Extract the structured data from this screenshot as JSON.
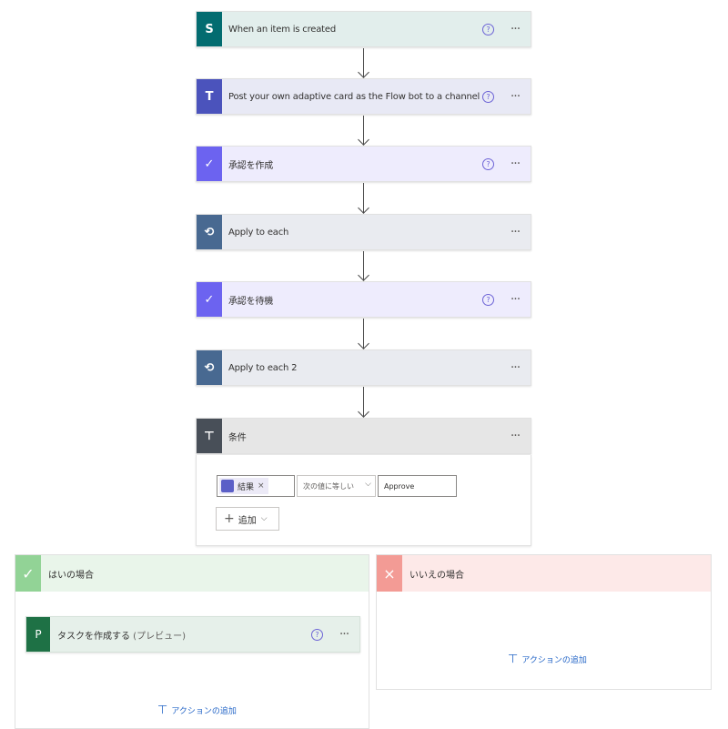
{
  "steps": [
    {
      "title": "When an item is created",
      "icon": "sharepoint-icon",
      "bg": "#e2eeec",
      "icon_bg": "#036c70",
      "glyph": "S",
      "help": "?",
      "more": "···"
    },
    {
      "title": "Post your own adaptive card as the Flow bot to a channel",
      "icon": "teams-icon",
      "bg": "#e8e9f5",
      "icon_bg": "#4b53bc",
      "glyph": "T",
      "help": "?",
      "more": "···"
    },
    {
      "title": "承認を作成",
      "icon": "approvals-icon",
      "bg": "#eeecfd",
      "icon_bg": "#6c63f0",
      "glyph": "✓",
      "help": "?",
      "more": "···"
    },
    {
      "title": "Apply to each",
      "icon": "loop-icon",
      "bg": "#e9ebf0",
      "icon_bg": "#486991",
      "glyph": "⟲",
      "more": "···"
    },
    {
      "title": "承認を待機",
      "icon": "approvals-icon",
      "bg": "#eeecfd",
      "icon_bg": "#6c63f0",
      "glyph": "✓",
      "help": "?",
      "more": "···"
    },
    {
      "title": "Apply to each 2",
      "icon": "loop-icon",
      "bg": "#e9ebf0",
      "icon_bg": "#486991",
      "glyph": "⟲",
      "more": "···"
    },
    {
      "title": "条件",
      "icon": "condition-icon",
      "bg": "#e6e6e6",
      "icon_bg": "#484f58",
      "glyph": "⊤",
      "more": "···"
    }
  ],
  "condition": {
    "token_label": "結果",
    "token_remove": "×",
    "operator": "次の値に等しい",
    "operator_chevron": "⌵",
    "value": "Approve",
    "add_label": "追加",
    "add_plus": "+",
    "add_chevron": "⌵"
  },
  "yes_branch": {
    "title": "はいの場合",
    "check": "✓",
    "color": "#92d396",
    "head_bg": "#e9f5ea",
    "inner_step": {
      "title": "タスクを作成する",
      "suffix": " (プレビュー)",
      "help": "?",
      "more": "···",
      "glyph": "P"
    },
    "add_action": "アクションの追加"
  },
  "no_branch": {
    "title": "いいえの場合",
    "x": "×",
    "color": "#f39b95",
    "head_bg": "#fde9e8",
    "add_action": "アクションの追加"
  }
}
